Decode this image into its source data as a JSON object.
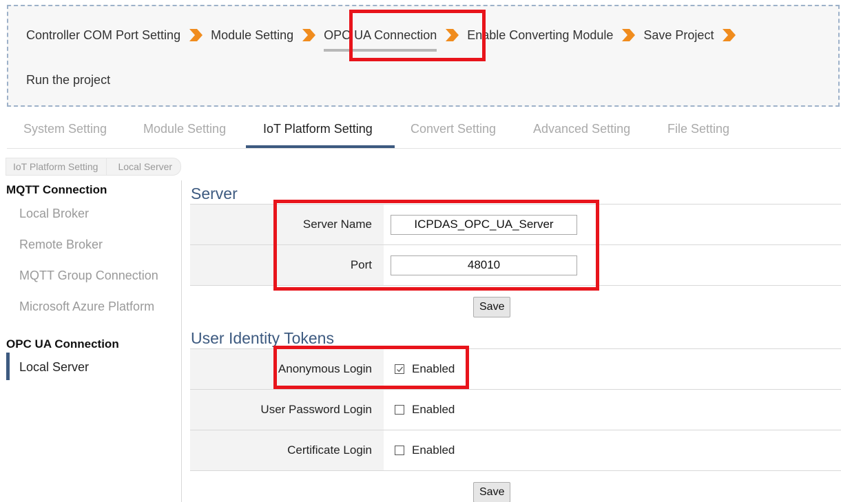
{
  "wizard": {
    "steps": [
      "Controller COM Port Setting",
      "Module Setting",
      "OPC UA Connection",
      "Enable Converting Module",
      "Save Project"
    ],
    "last_step": "Run the project",
    "current_step": "OPC UA Connection"
  },
  "tabs": [
    "System Setting",
    "Module Setting",
    "IoT Platform Setting",
    "Convert Setting",
    "Advanced Setting",
    "File Setting"
  ],
  "breadcrumb": [
    "IoT Platform Setting",
    "Local Server"
  ],
  "sidebar": {
    "mqtt_heading": "MQTT Connection",
    "mqtt_items": [
      "Local Broker",
      "Remote Broker",
      "MQTT Group Connection",
      "Microsoft Azure Platform"
    ],
    "opcua_heading": "OPC UA Connection",
    "opcua_items": [
      "Local Server"
    ]
  },
  "server": {
    "title": "Server",
    "name_label": "Server Name",
    "name_value": "ICPDAS_OPC_UA_Server",
    "port_label": "Port",
    "port_value": "48010",
    "save_label": "Save"
  },
  "tokens": {
    "title": "User Identity Tokens",
    "rows": [
      {
        "label": "Anonymous Login",
        "option": "Enabled",
        "checked": true
      },
      {
        "label": "User Password Login",
        "option": "Enabled",
        "checked": false
      },
      {
        "label": "Certificate Login",
        "option": "Enabled",
        "checked": false
      }
    ],
    "save_label": "Save"
  },
  "colors": {
    "accent": "#3d5a80",
    "arrow": "#f08c1e",
    "annotation": "#e8141b"
  }
}
